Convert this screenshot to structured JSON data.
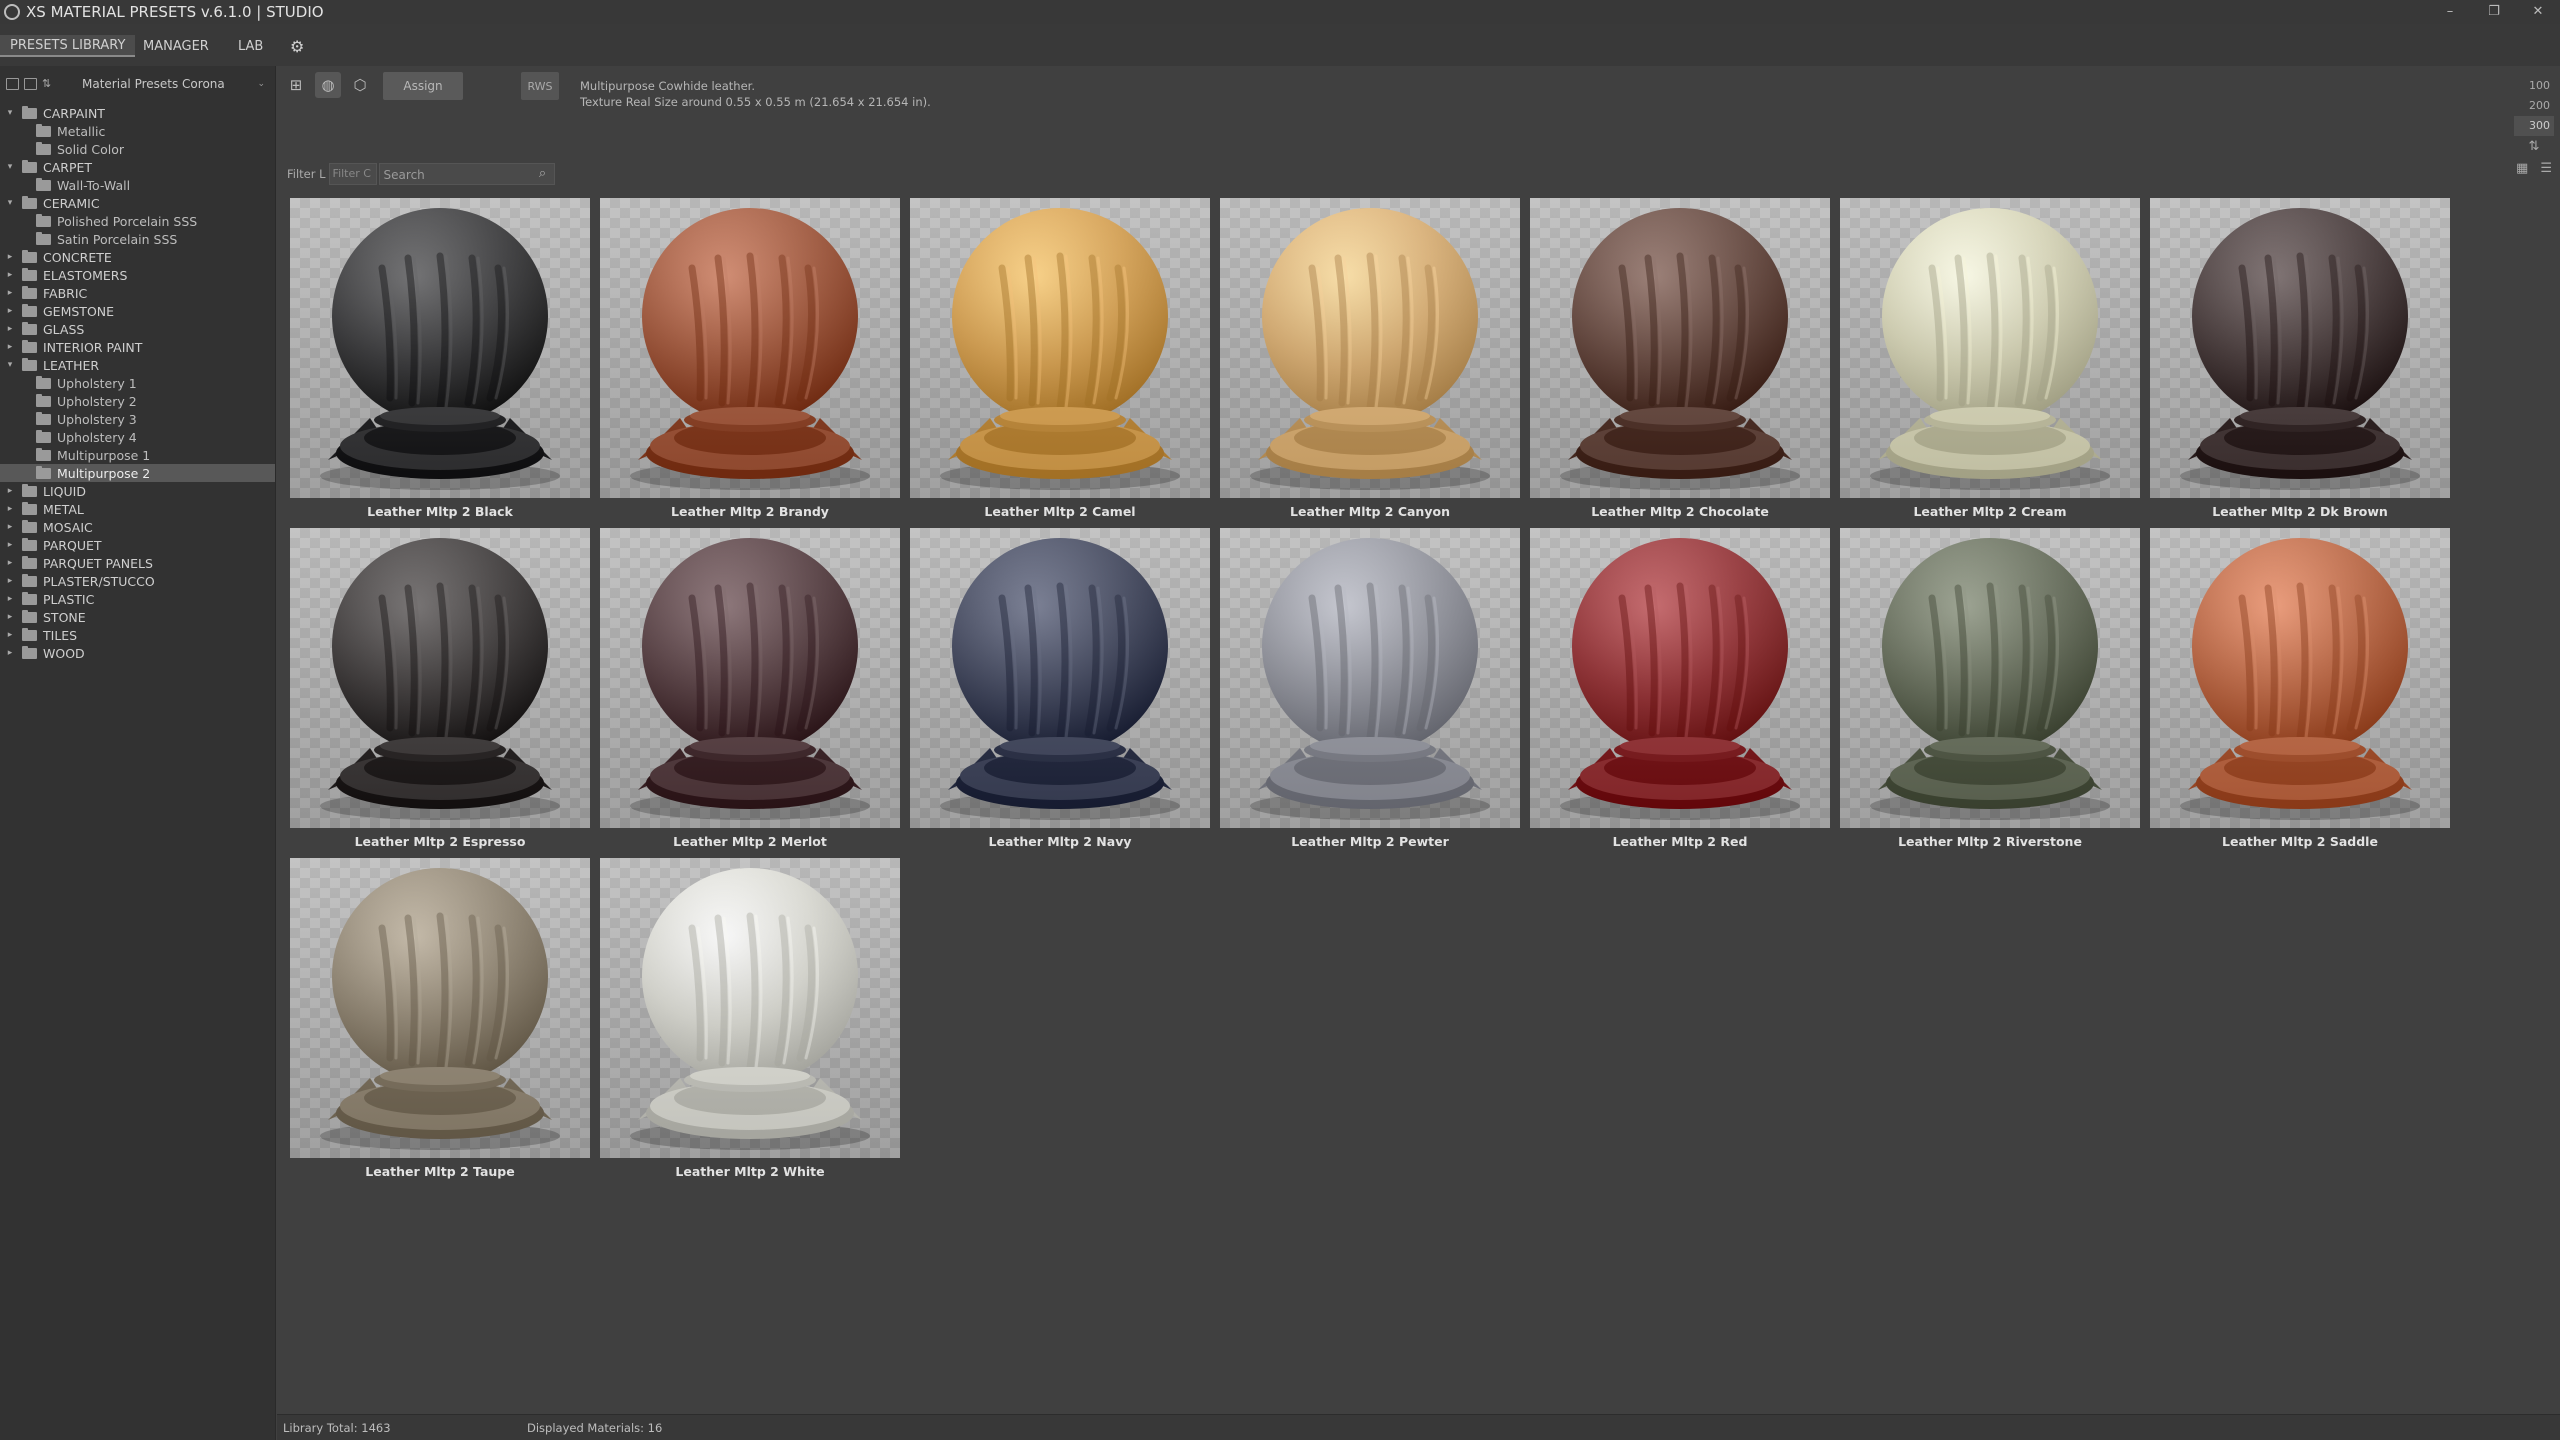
{
  "window": {
    "title": "XS MATERIAL PRESETS v.6.1.0 | STUDIO",
    "controls": [
      "–",
      "❐",
      "✕"
    ]
  },
  "main_tabs": [
    {
      "label": "PRESETS LIBRARY",
      "active": true
    },
    {
      "label": "MANAGER",
      "active": false
    },
    {
      "label": "LAB",
      "active": false
    }
  ],
  "sidebar": {
    "library_select": "Material Presets Corona",
    "tree": [
      {
        "label": "CARPAINT",
        "level": 0,
        "expanded": true
      },
      {
        "label": "Metallic",
        "level": 1
      },
      {
        "label": "Solid Color",
        "level": 1
      },
      {
        "label": "CARPET",
        "level": 0,
        "expanded": true
      },
      {
        "label": "Wall-To-Wall",
        "level": 1
      },
      {
        "label": "CERAMIC",
        "level": 0,
        "expanded": true
      },
      {
        "label": "Polished Porcelain SSS",
        "level": 1
      },
      {
        "label": "Satin Porcelain SSS",
        "level": 1
      },
      {
        "label": "CONCRETE",
        "level": 0
      },
      {
        "label": "ELASTOMERS",
        "level": 0
      },
      {
        "label": "FABRIC",
        "level": 0
      },
      {
        "label": "GEMSTONE",
        "level": 0
      },
      {
        "label": "GLASS",
        "level": 0
      },
      {
        "label": "INTERIOR PAINT",
        "level": 0
      },
      {
        "label": "LEATHER",
        "level": 0,
        "expanded": true
      },
      {
        "label": "Upholstery 1",
        "level": 1
      },
      {
        "label": "Upholstery 2",
        "level": 1
      },
      {
        "label": "Upholstery 3",
        "level": 1
      },
      {
        "label": "Upholstery 4",
        "level": 1
      },
      {
        "label": "Multipurpose 1",
        "level": 1
      },
      {
        "label": "Multipurpose 2",
        "level": 1,
        "selected": true
      },
      {
        "label": "LIQUID",
        "level": 0
      },
      {
        "label": "METAL",
        "level": 0
      },
      {
        "label": "MOSAIC",
        "level": 0
      },
      {
        "label": "PARQUET",
        "level": 0
      },
      {
        "label": "PARQUET PANELS",
        "level": 0
      },
      {
        "label": "PLASTER/STUCCO",
        "level": 0
      },
      {
        "label": "PLASTIC",
        "level": 0
      },
      {
        "label": "STONE",
        "level": 0
      },
      {
        "label": "TILES",
        "level": 0
      },
      {
        "label": "WOOD",
        "level": 0
      }
    ]
  },
  "toolbar": {
    "assign_label": "Assign",
    "rws_label": "RWS",
    "description_line1": "Multipurpose Cowhide leather.",
    "description_line2": "Texture Real Size around 0.55 x 0.55 m (21.654 x 21.654 in)."
  },
  "filter": {
    "label": "Filter L",
    "filter_placeholder": "Filter C",
    "search_placeholder": "Search"
  },
  "size_options": [
    {
      "label": "100",
      "active": false
    },
    {
      "label": "200",
      "active": false
    },
    {
      "label": "300",
      "active": true
    }
  ],
  "materials": [
    {
      "name": "Leather Mltp 2 Black",
      "color": "#2a2a2c"
    },
    {
      "name": "Leather Mltp 2 Brandy",
      "color": "#9a4a2c"
    },
    {
      "name": "Leather Mltp 2 Camel",
      "color": "#d49a44"
    },
    {
      "name": "Leather Mltp 2 Canyon",
      "color": "#d8aa6a"
    },
    {
      "name": "Leather Mltp 2 Chocolate",
      "color": "#5a3a30"
    },
    {
      "name": "Leather Mltp 2 Cream",
      "color": "#d4d2b2"
    },
    {
      "name": "Leather Mltp 2 Dk Brown",
      "color": "#3a2c2c"
    },
    {
      "name": "Leather Mltp 2 Espresso",
      "color": "#302c2c"
    },
    {
      "name": "Leather Mltp 2 Merlot",
      "color": "#4a3034"
    },
    {
      "name": "Leather Mltp 2 Navy",
      "color": "#343a52"
    },
    {
      "name": "Leather Mltp 2 Pewter",
      "color": "#8c8e98"
    },
    {
      "name": "Leather Mltp 2 Red",
      "color": "#8c2226"
    },
    {
      "name": "Leather Mltp 2 Riverstone",
      "color": "#5c6450"
    },
    {
      "name": "Leather Mltp 2 Saddle",
      "color": "#b85c36"
    },
    {
      "name": "Leather Mltp 2 Taupe",
      "color": "#8a7e6a"
    },
    {
      "name": "Leather Mltp 2 White",
      "color": "#d8d8d0"
    }
  ],
  "status": {
    "library_total": "Library Total: 1463",
    "displayed": "Displayed Materials: 16"
  }
}
